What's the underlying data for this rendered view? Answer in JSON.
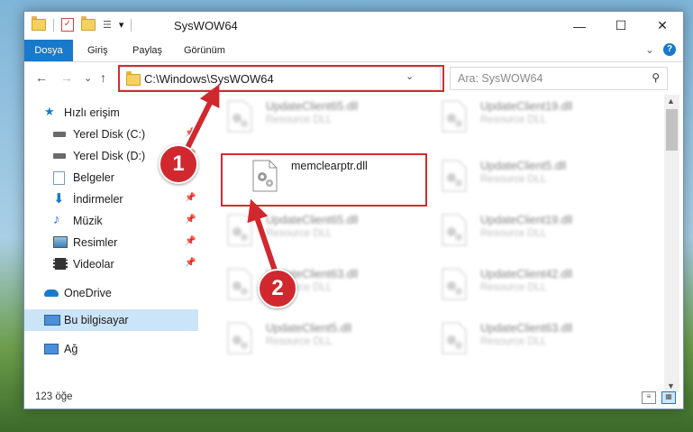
{
  "window": {
    "title": "SysWOW64",
    "qat_dropdown": "▾"
  },
  "window_controls": {
    "minimize": "—",
    "maximize": "☐",
    "close": "✕"
  },
  "ribbon": {
    "tabs": [
      {
        "label": "Dosya",
        "accent": "#1979ca"
      },
      {
        "label": "Giriş"
      },
      {
        "label": "Paylaş"
      },
      {
        "label": "Görünüm"
      }
    ],
    "expand": "⌄",
    "help": "?"
  },
  "nav_buttons": {
    "back": "←",
    "forward": "→",
    "recent": "⌄",
    "up": "↑"
  },
  "address_bar": {
    "path": "C:\\Windows\\SysWOW64",
    "dropdown": "⌄",
    "refresh": "↻"
  },
  "search": {
    "placeholder": "Ara: SysWOW64",
    "icon": "search-icon",
    "icon_glyph": "⚲"
  },
  "navigation_pane": {
    "items": [
      {
        "label": "Hızlı erişim",
        "icon": "star-icon",
        "pinned": false
      },
      {
        "label": "Yerel Disk (C:)",
        "icon": "drive-icon",
        "pinned": true
      },
      {
        "label": "Yerel Disk (D:)",
        "icon": "drive-icon",
        "pinned": true
      },
      {
        "label": "Belgeler",
        "icon": "documents-icon",
        "pinned": true
      },
      {
        "label": "İndirmeler",
        "icon": "download-icon",
        "pinned": true
      },
      {
        "label": "Müzik",
        "icon": "music-icon",
        "pinned": true
      },
      {
        "label": "Resimler",
        "icon": "pictures-icon",
        "pinned": true
      },
      {
        "label": "Videolar",
        "icon": "videos-icon",
        "pinned": true
      },
      {
        "label": "OneDrive",
        "icon": "cloud-icon",
        "pinned": false
      },
      {
        "label": "Bu bilgisayar",
        "icon": "computer-icon",
        "pinned": false,
        "selected": true
      },
      {
        "label": "Ağ",
        "icon": "network-icon",
        "pinned": false
      }
    ],
    "pin_glyph": "📌"
  },
  "files": [
    {
      "name": "UpdateClient65.dll",
      "type": "Resource DLL",
      "blurred": true
    },
    {
      "name": "UpdateClient19.dll",
      "type": "Resource DLL",
      "blurred": true
    },
    {
      "name": "memclearptr.dll",
      "type": "",
      "blurred": false,
      "highlighted": true
    },
    {
      "name": "UpdateClient5.dll",
      "type": "Resource DLL",
      "blurred": true
    },
    {
      "name": "UpdateClient65.dll",
      "type": "Resource DLL",
      "blurred": true
    },
    {
      "name": "UpdateClient19.dll",
      "type": "Resource DLL",
      "blurred": true
    },
    {
      "name": "UpdateClient63.dll",
      "type": "Resource DLL",
      "blurred": true
    },
    {
      "name": "UpdateClient42.dll",
      "type": "Resource DLL",
      "blurred": true
    },
    {
      "name": "UpdateClient5.dll",
      "type": "Resource DLL",
      "blurred": true
    },
    {
      "name": "UpdateClient63.dll",
      "type": "Resource DLL",
      "blurred": true
    }
  ],
  "status_bar": {
    "item_count": "123 öğe"
  },
  "annotations": {
    "step1": "1",
    "step2": "2",
    "color": "#d0282e"
  }
}
